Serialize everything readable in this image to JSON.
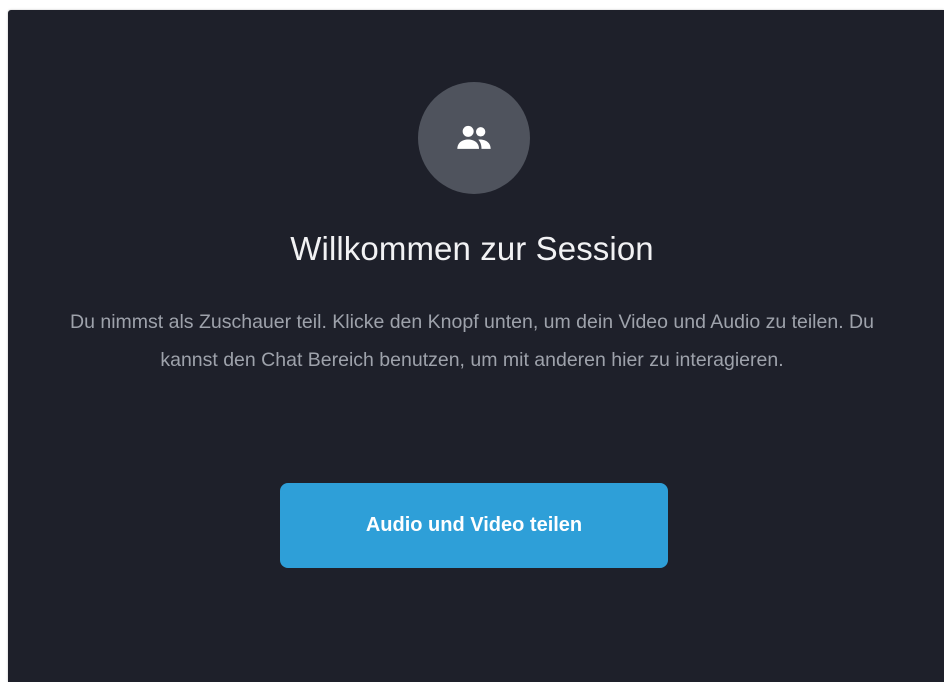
{
  "session": {
    "icon": "users-icon",
    "title": "Willkommen zur Session",
    "description": "Du nimmst als Zuschauer teil. Klicke den Knopf unten, um dein Video und Audio zu teilen. Du kannst den Chat Bereich benutzen, um mit anderen hier zu interagieren.",
    "share_button_label": "Audio und Video teilen"
  },
  "colors": {
    "background": "#1e202a",
    "avatar": "#4f535d",
    "accent": "#2e9fd8",
    "title_text": "#f2f2f4",
    "body_text": "#9ea2ab"
  }
}
